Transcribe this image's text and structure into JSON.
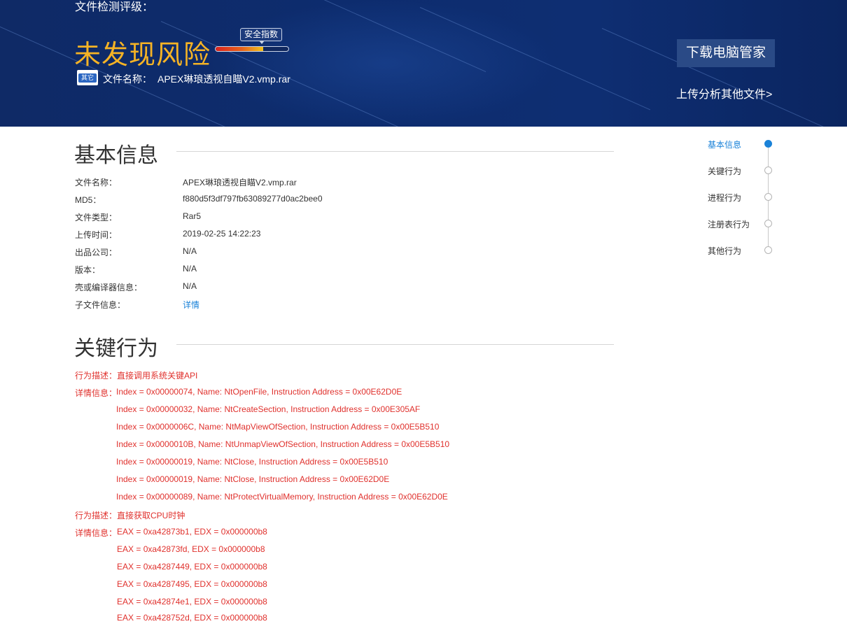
{
  "header": {
    "eval_label": "文件检测评级：",
    "risk_title": "未发现风险",
    "safety_tag": "安全指数",
    "safety_level": 0.65,
    "file_icon_tag": "其它",
    "file_name_label": "文件名称：",
    "file_name": "APEX琳琅透视自瞄V2.vmp.rar",
    "download_button": "下载电脑管家",
    "upload_link": "上传分析其他文件>"
  },
  "basic_info": {
    "title": "基本信息",
    "rows": [
      {
        "key": "文件名称：",
        "value": "APEX琳琅透视自瞄V2.vmp.rar"
      },
      {
        "key": "MD5：",
        "value": "f880d5f3df797fb63089277d0ac2bee0"
      },
      {
        "key": "文件类型：",
        "value": "Rar5"
      },
      {
        "key": "上传时间：",
        "value": "2019-02-25 14:22:23"
      },
      {
        "key": "出品公司：",
        "value": "N/A"
      },
      {
        "key": "版本：",
        "value": "N/A"
      },
      {
        "key": "壳或编译器信息：",
        "value": "N/A"
      },
      {
        "key": "子文件信息：",
        "value": "详情"
      }
    ]
  },
  "key_behavior": {
    "title": "关键行为",
    "groups": [
      {
        "desc_label": "行为描述：",
        "desc": "直接调用系统关键API",
        "detail_label": "详情信息：",
        "details": [
          "Index = 0x00000074, Name: NtOpenFile, Instruction Address = 0x00E62D0E",
          "Index = 0x00000032, Name: NtCreateSection, Instruction Address = 0x00E305AF",
          "Index = 0x0000006C, Name: NtMapViewOfSection, Instruction Address = 0x00E5B510",
          "Index = 0x0000010B, Name: NtUnmapViewOfSection, Instruction Address = 0x00E5B510",
          "Index = 0x00000019, Name: NtClose, Instruction Address = 0x00E5B510",
          "Index = 0x00000019, Name: NtClose, Instruction Address = 0x00E62D0E",
          "Index = 0x00000089, Name: NtProtectVirtualMemory, Instruction Address = 0x00E62D0E"
        ]
      },
      {
        "desc_label": "行为描述：",
        "desc": "直接获取CPU时钟",
        "detail_label": "详情信息：",
        "details": [
          "EAX = 0xa42873b1, EDX = 0x000000b8",
          "EAX = 0xa42873fd, EDX = 0x000000b8",
          "EAX = 0xa4287449, EDX = 0x000000b8",
          "EAX = 0xa4287495, EDX = 0x000000b8",
          "EAX = 0xa42874e1, EDX = 0x000000b8",
          "EAX = 0xa428752d, EDX = 0x000000b8"
        ]
      }
    ]
  },
  "side_nav": {
    "items": [
      "基本信息",
      "关键行为",
      "进程行为",
      "注册表行为",
      "其他行为"
    ],
    "active": "基本信息"
  },
  "colors": {
    "banner_bg": "#0d2c6e",
    "risk_title": "#f5b325",
    "link_blue": "#1a82d8",
    "behavior_red": "#e0312d"
  }
}
